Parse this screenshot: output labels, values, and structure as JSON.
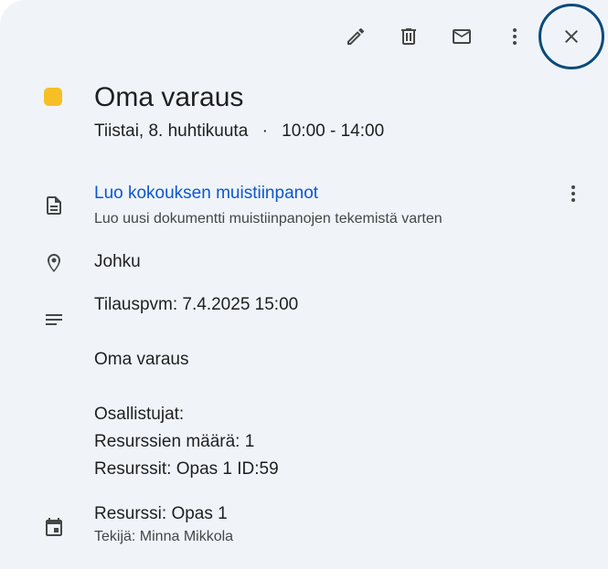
{
  "toolbar": {
    "edit_icon": "pencil-icon",
    "delete_icon": "trash-icon",
    "email_icon": "mail-icon",
    "more_icon": "more-vert-icon",
    "close_icon": "close-icon"
  },
  "event": {
    "color": "#f6bf26",
    "title": "Oma varaus",
    "date": "Tiistai, 8. huhtikuuta",
    "separator": "·",
    "time": "10:00 - 14:00"
  },
  "notes": {
    "link_label": "Luo kokouksen muistiinpanot",
    "description": "Luo uusi dokumentti muistiinpanojen tekemistä varten"
  },
  "location": "Johku",
  "description_lines": [
    "Tilauspvm: 7.4.2025 15:00",
    "",
    "Oma varaus",
    "",
    "Osallistujat:",
    "Resurssien määrä: 1",
    "Resurssit: Opas 1 ID:59"
  ],
  "calendar": {
    "name": "Resurssi: Opas 1",
    "creator": "Tekijä: Minna Mikkola"
  }
}
